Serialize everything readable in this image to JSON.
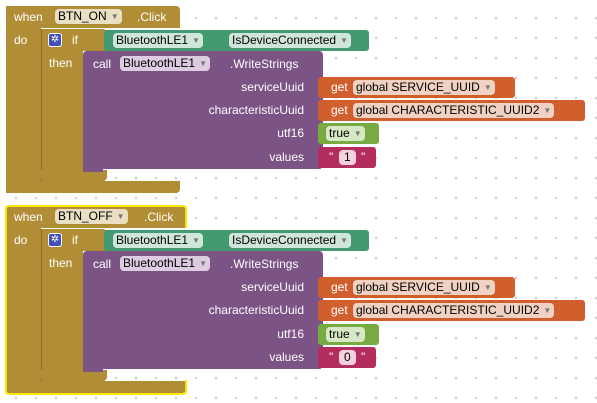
{
  "colors": {
    "event": "#b18e35",
    "control": "#b18e35",
    "method": "#7c5385",
    "getter": "#d05f2d",
    "logic": "#77ab41",
    "text": "#b32d5e",
    "component_ref": "#439970",
    "selected_outline": "#fce800"
  },
  "blocks": [
    {
      "event_kw": "when",
      "component": "BTN_ON",
      "event": ".Click",
      "do_kw": "do",
      "if_kw": "if",
      "then_kw": "then",
      "condition_component": "BluetoothLE1",
      "condition_property": "IsDeviceConnected",
      "call_kw": "call",
      "call_component": "BluetoothLE1",
      "call_method": ".WriteStrings",
      "arg_labels": [
        "serviceUuid",
        "characteristicUuid",
        "utf16",
        "values"
      ],
      "get_kw": "get",
      "service_var": "global SERVICE_UUID",
      "char_var": "global CHARACTERISTIC_UUID2",
      "utf16_value": "true",
      "string_value": "1",
      "quote_open": "\"",
      "quote_close": "\""
    },
    {
      "event_kw": "when",
      "component": "BTN_OFF",
      "event": ".Click",
      "do_kw": "do",
      "if_kw": "if",
      "then_kw": "then",
      "condition_component": "BluetoothLE1",
      "condition_property": "IsDeviceConnected",
      "call_kw": "call",
      "call_component": "BluetoothLE1",
      "call_method": ".WriteStrings",
      "arg_labels": [
        "serviceUuid",
        "characteristicUuid",
        "utf16",
        "values"
      ],
      "get_kw": "get",
      "service_var": "global SERVICE_UUID",
      "char_var": "global CHARACTERISTIC_UUID2",
      "utf16_value": "true",
      "string_value": "0",
      "quote_open": "\"",
      "quote_close": "\""
    }
  ]
}
